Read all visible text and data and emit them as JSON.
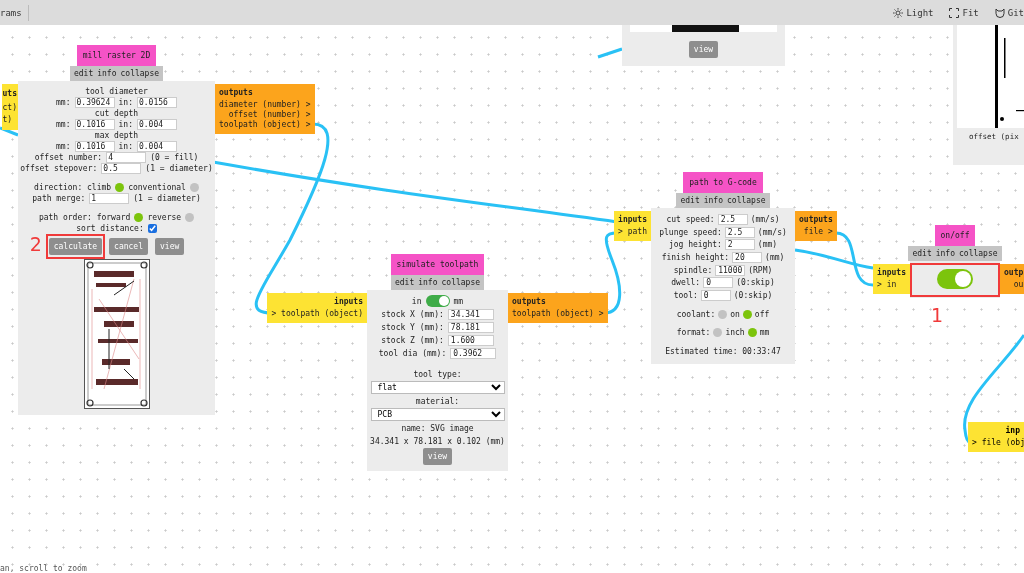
{
  "toolbar": {
    "left_text": "rams",
    "items": [
      {
        "kind": "light",
        "label": "Light"
      },
      {
        "kind": "fit",
        "label": "Fit"
      },
      {
        "kind": "git",
        "label": "Git"
      }
    ]
  },
  "nodes": [
    {
      "kind": "module",
      "title": "mill raster 2D",
      "actions": [
        "edit",
        "info",
        "collapse"
      ],
      "inputs": {
        "title": "uts",
        "ports": [
          "ct)",
          "t)"
        ]
      },
      "outputs": {
        "title": "outputs",
        "ports": [
          "diameter (number) >",
          "offset (number) >",
          "toolpath (object) >"
        ]
      },
      "sections": [
        [
          [
            {
              "kind": "text",
              "text": "tool diameter"
            }
          ],
          [
            {
              "kind": "text",
              "text": "mm:"
            },
            {
              "kind": "input",
              "value": "0.39624"
            },
            {
              "kind": "text",
              "text": "in:"
            },
            {
              "kind": "input",
              "value": "0.0156"
            }
          ],
          [
            {
              "kind": "text",
              "text": "cut depth"
            }
          ],
          [
            {
              "kind": "text",
              "text": "mm:"
            },
            {
              "kind": "input",
              "value": "0.1016"
            },
            {
              "kind": "text",
              "text": "in:"
            },
            {
              "kind": "input",
              "value": "0.004"
            }
          ],
          [
            {
              "kind": "text",
              "text": "max depth"
            }
          ],
          [
            {
              "kind": "text",
              "text": "mm:"
            },
            {
              "kind": "input",
              "value": "0.1016"
            },
            {
              "kind": "text",
              "text": "in:"
            },
            {
              "kind": "input",
              "value": "0.004"
            }
          ],
          [
            {
              "kind": "text",
              "text": "offset number:"
            },
            {
              "kind": "input",
              "value": "4"
            },
            {
              "kind": "text",
              "text": "(0 = fill)"
            }
          ],
          [
            {
              "kind": "text",
              "text": "offset stepover:"
            },
            {
              "kind": "input",
              "value": "0.5"
            },
            {
              "kind": "text",
              "text": "(1 = diameter)"
            }
          ]
        ],
        [
          [
            {
              "kind": "text",
              "text": "direction: climb"
            },
            {
              "kind": "radio",
              "selected": true
            },
            {
              "kind": "text",
              "text": "conventional"
            },
            {
              "kind": "radio",
              "selected": false
            }
          ],
          [
            {
              "kind": "text",
              "text": "path merge:"
            },
            {
              "kind": "input",
              "value": "1"
            },
            {
              "kind": "text",
              "text": "(1 = diameter)"
            }
          ]
        ],
        [
          [
            {
              "kind": "text",
              "text": "path order: forward"
            },
            {
              "kind": "radio",
              "selected": true
            },
            {
              "kind": "text",
              "text": "reverse"
            },
            {
              "kind": "radio",
              "selected": false
            }
          ],
          [
            {
              "kind": "text",
              "text": "sort distance:"
            },
            {
              "kind": "checkbox",
              "checked": true
            }
          ],
          [
            {
              "kind": "button",
              "label": "calculate"
            },
            {
              "kind": "button",
              "label": "cancel"
            },
            {
              "kind": "button",
              "label": "view"
            }
          ],
          [
            {
              "kind": "picture"
            }
          ]
        ]
      ]
    },
    {
      "kind": "module",
      "title": "simulate toolpath",
      "actions": [
        "edit",
        "info",
        "collapse"
      ],
      "inputs": {
        "title": "inputs",
        "ports": [
          "> toolpath (object)"
        ]
      },
      "outputs": {
        "title": "outputs",
        "ports": [
          "toolpath (object) >"
        ]
      },
      "sections": [
        [
          [
            {
              "kind": "text",
              "text": "in"
            },
            {
              "kind": "toggle",
              "on": true
            },
            {
              "kind": "text",
              "text": "mm"
            }
          ],
          [
            {
              "kind": "text",
              "text": "stock X (mm):"
            },
            {
              "kind": "input",
              "value": "34.341"
            }
          ],
          [
            {
              "kind": "text",
              "text": "stock Y (mm):"
            },
            {
              "kind": "input",
              "value": "78.181"
            }
          ],
          [
            {
              "kind": "text",
              "text": "stock Z (mm):"
            },
            {
              "kind": "input",
              "value": "1.600"
            }
          ],
          [
            {
              "kind": "text",
              "text": "tool dia (mm):"
            },
            {
              "kind": "input",
              "value": "0.3962"
            }
          ]
        ],
        [
          [
            {
              "kind": "text",
              "text": "tool type:"
            }
          ],
          [
            {
              "kind": "select",
              "value": "flat"
            }
          ],
          [
            {
              "kind": "text",
              "text": "material:"
            }
          ],
          [
            {
              "kind": "select",
              "value": "PCB"
            }
          ],
          [
            {
              "kind": "text",
              "text": "name: SVG image"
            }
          ],
          [
            {
              "kind": "text",
              "text": "34.341 x 78.181 x 0.102 (mm)"
            }
          ],
          [
            {
              "kind": "button",
              "label": "view"
            }
          ]
        ]
      ]
    },
    {
      "kind": "module",
      "title": "path to G-code",
      "actions": [
        "edit",
        "info",
        "collapse"
      ],
      "inputs": {
        "title": "inputs",
        "ports": [
          "> path"
        ]
      },
      "outputs": {
        "title": "outputs",
        "ports": [
          "file >"
        ]
      },
      "sections": [
        [
          [
            {
              "kind": "text",
              "text": "cut speed:"
            },
            {
              "kind": "input",
              "value": "2.5"
            },
            {
              "kind": "text",
              "text": "(mm/s)"
            }
          ],
          [
            {
              "kind": "text",
              "text": "plunge speed:"
            },
            {
              "kind": "input",
              "value": "2.5"
            },
            {
              "kind": "text",
              "text": "(mm/s)"
            }
          ],
          [
            {
              "kind": "text",
              "text": "jog height:"
            },
            {
              "kind": "input",
              "value": "2"
            },
            {
              "kind": "text",
              "text": "(mm)"
            }
          ],
          [
            {
              "kind": "text",
              "text": "finish height:"
            },
            {
              "kind": "input",
              "value": "20"
            },
            {
              "kind": "text",
              "text": "(mm)"
            }
          ],
          [
            {
              "kind": "text",
              "text": "spindle:"
            },
            {
              "kind": "input",
              "value": "11000"
            },
            {
              "kind": "text",
              "text": "(RPM)"
            }
          ],
          [
            {
              "kind": "text",
              "text": "dwell:"
            },
            {
              "kind": "input",
              "value": "0"
            },
            {
              "kind": "text",
              "text": "(0:skip)"
            }
          ],
          [
            {
              "kind": "text",
              "text": "tool:"
            },
            {
              "kind": "input",
              "value": "0"
            },
            {
              "kind": "text",
              "text": "(0:skip)"
            }
          ]
        ],
        [
          [
            {
              "kind": "text",
              "text": "coolant:"
            },
            {
              "kind": "radio",
              "selected": false
            },
            {
              "kind": "text",
              "text": "on"
            },
            {
              "kind": "radio",
              "selected": true
            },
            {
              "kind": "text",
              "text": "off"
            }
          ]
        ],
        [
          [
            {
              "kind": "text",
              "text": "format:"
            },
            {
              "kind": "radio",
              "selected": false
            },
            {
              "kind": "text",
              "text": "inch"
            },
            {
              "kind": "radio",
              "selected": true
            },
            {
              "kind": "text",
              "text": "mm"
            }
          ]
        ],
        [
          [
            {
              "kind": "text",
              "text": "Estimated time: 00:33:47"
            }
          ]
        ]
      ]
    },
    {
      "kind": "module",
      "title": "on/off",
      "actions": [
        "edit",
        "info",
        "collapse"
      ],
      "inputs": {
        "title": "inputs",
        "ports": [
          "> in"
        ]
      },
      "outputs": {
        "title": "outp",
        "ports": [
          "ou"
        ]
      },
      "sections": [
        [
          [
            {
              "kind": "toggle",
              "on": true
            }
          ]
        ]
      ]
    },
    {
      "kind": "preview",
      "button": "view"
    },
    {
      "kind": "preview",
      "caption": "offset (pix"
    },
    {
      "kind": "stub",
      "inputs": {
        "title": "inp",
        "ports": [
          "> file (obj"
        ]
      }
    }
  ],
  "annotations": [
    {
      "label": "2"
    },
    {
      "label": "1"
    }
  ],
  "status": "an, scroll to zoom"
}
